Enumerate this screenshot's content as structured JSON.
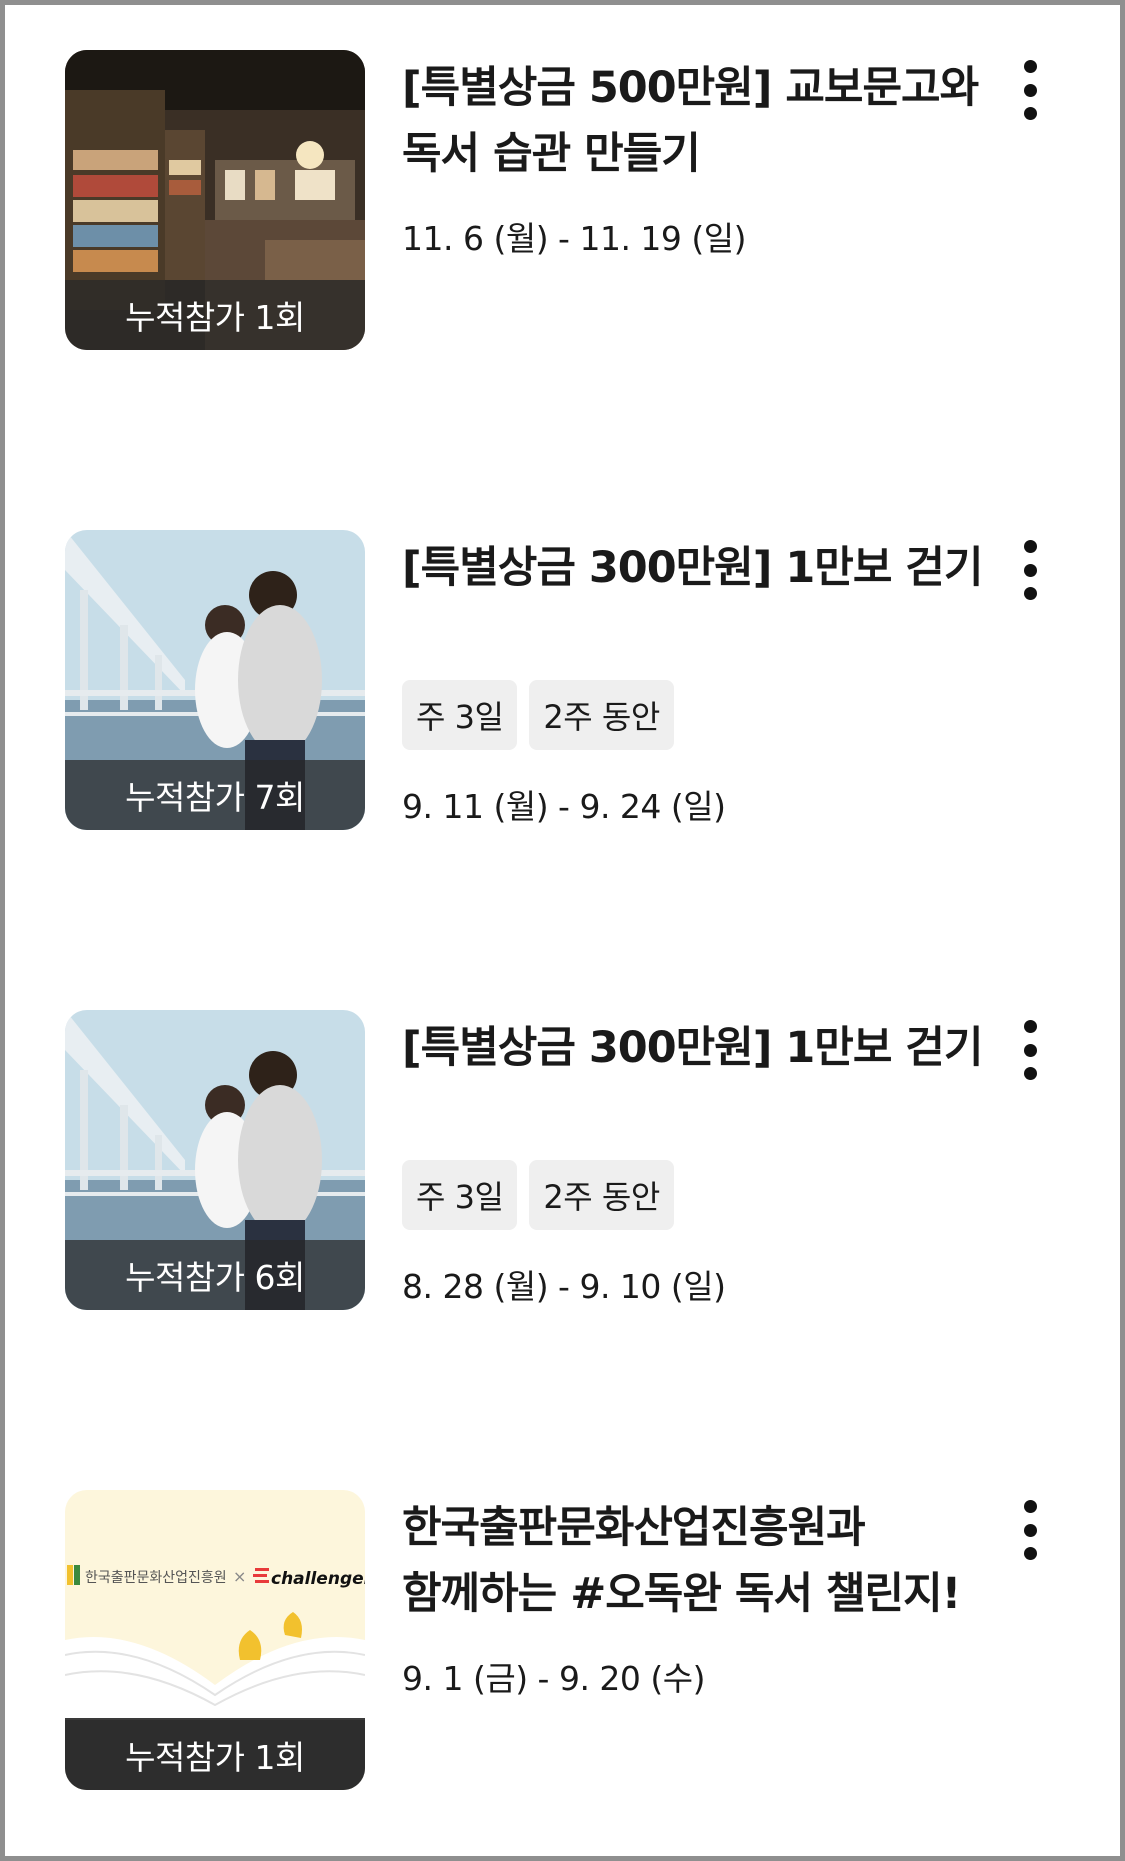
{
  "challenges": [
    {
      "title": "[특별상금 500만원] 교보문고와 독서 습관 만들기",
      "participation": "누적참가 1회",
      "tags": [],
      "date_range": "11. 6 (월) - 11. 19 (일)",
      "thumbnail": "bookstore-photo"
    },
    {
      "title": "[특별상금 300만원] 1만보 걷기",
      "participation": "누적참가 7회",
      "tags": [
        "주 3일",
        "2주 동안"
      ],
      "date_range": "9. 11 (월) - 9. 24 (일)",
      "thumbnail": "walking-women-photo"
    },
    {
      "title": "[특별상금 300만원] 1만보 걷기",
      "participation": "누적참가 6회",
      "tags": [
        "주 3일",
        "2주 동안"
      ],
      "date_range": "8. 28 (월) - 9. 10 (일)",
      "thumbnail": "walking-women-photo"
    },
    {
      "title": "한국출판문화산업진흥원과 함께하는 #오독완 독서 챌린지!",
      "participation": "누적참가 1회",
      "tags": [],
      "date_range": "9. 1 (금) - 9. 20 (수)",
      "thumbnail": "book-challenge-banner",
      "banner_text": {
        "org": "한국출판문화산업진흥원",
        "brand": "challengers"
      }
    }
  ],
  "icons": {
    "menu": "more-vertical-icon"
  },
  "colors": {
    "text": "#1a1a1a",
    "tag_bg": "#efefef",
    "overlay": "#282828",
    "banner_bg": "#fdf6dc",
    "ginkgo": "#f2c12e"
  }
}
